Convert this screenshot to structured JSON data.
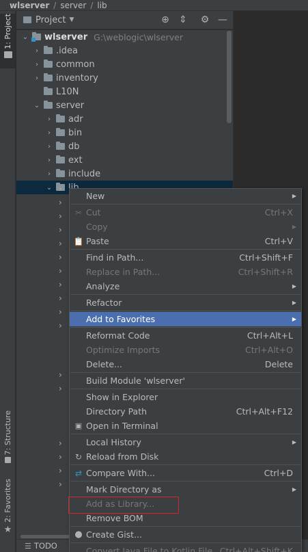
{
  "breadcrumb": [
    "wlserver",
    "server",
    "lib"
  ],
  "tool_window_tabs": {
    "project": "1: Project",
    "structure": "7: Structure",
    "favorites": "2: Favorites"
  },
  "project_panel": {
    "title": "Project"
  },
  "tree": {
    "root": {
      "name": "wlserver",
      "path": "G:\\weblogic\\wlserver"
    },
    "items": [
      {
        "name": ".idea",
        "arrow": "›"
      },
      {
        "name": "common",
        "arrow": "›"
      },
      {
        "name": "inventory",
        "arrow": "›"
      },
      {
        "name": "L10N",
        "arrow": ""
      },
      {
        "name": "server",
        "arrow": "⌄"
      },
      {
        "name": "adr",
        "arrow": "›"
      },
      {
        "name": "bin",
        "arrow": "›"
      },
      {
        "name": "db",
        "arrow": "›"
      },
      {
        "name": "ext",
        "arrow": "›"
      },
      {
        "name": "include",
        "arrow": "›"
      },
      {
        "name": "lib",
        "arrow": "⌄"
      }
    ]
  },
  "context_menu": {
    "items": [
      {
        "label": "New",
        "shortcut": "",
        "submenu": true
      },
      {
        "label": "Cut",
        "shortcut": "Ctrl+X",
        "icon": "scissors-icon"
      },
      {
        "label": "Copy",
        "shortcut": "",
        "submenu": true
      },
      {
        "label": "Paste",
        "shortcut": "Ctrl+V",
        "icon": "clipboard-icon"
      },
      {
        "label": "Find in Path...",
        "shortcut": "Ctrl+Shift+F"
      },
      {
        "label": "Replace in Path...",
        "shortcut": "Ctrl+Shift+R"
      },
      {
        "label": "Analyze",
        "shortcut": "",
        "submenu": true
      },
      {
        "label": "Refactor",
        "shortcut": "",
        "submenu": true
      },
      {
        "label": "Add to Favorites",
        "shortcut": "",
        "submenu": true
      },
      {
        "label": "Reformat Code",
        "shortcut": "Ctrl+Alt+L"
      },
      {
        "label": "Optimize Imports",
        "shortcut": "Ctrl+Alt+O"
      },
      {
        "label": "Delete...",
        "shortcut": "Delete"
      },
      {
        "label": "Build Module 'wlserver'",
        "shortcut": ""
      },
      {
        "label": "Show in Explorer",
        "shortcut": ""
      },
      {
        "label": "Directory Path",
        "shortcut": "Ctrl+Alt+F12"
      },
      {
        "label": "Open in Terminal",
        "shortcut": "",
        "icon": "terminal-icon"
      },
      {
        "label": "Local History",
        "shortcut": "",
        "submenu": true
      },
      {
        "label": "Reload from Disk",
        "shortcut": "",
        "icon": "reload-icon"
      },
      {
        "label": "Compare With...",
        "shortcut": "Ctrl+D",
        "icon": "compare-icon"
      },
      {
        "label": "Mark Directory as",
        "shortcut": "",
        "submenu": true
      },
      {
        "label": "Add as Library...",
        "shortcut": ""
      },
      {
        "label": "Remove BOM",
        "shortcut": ""
      },
      {
        "label": "Create Gist...",
        "shortcut": "",
        "icon": "github-icon"
      },
      {
        "label": "Convert Java File to Kotlin File",
        "shortcut": "Ctrl+Alt+Shift+K"
      }
    ]
  },
  "bottom_bar": {
    "todo": "TODO"
  },
  "colors": {
    "selection": "#4b6eaf",
    "red_highlight": "#d4262a",
    "tree_selected": "#0d293e"
  }
}
